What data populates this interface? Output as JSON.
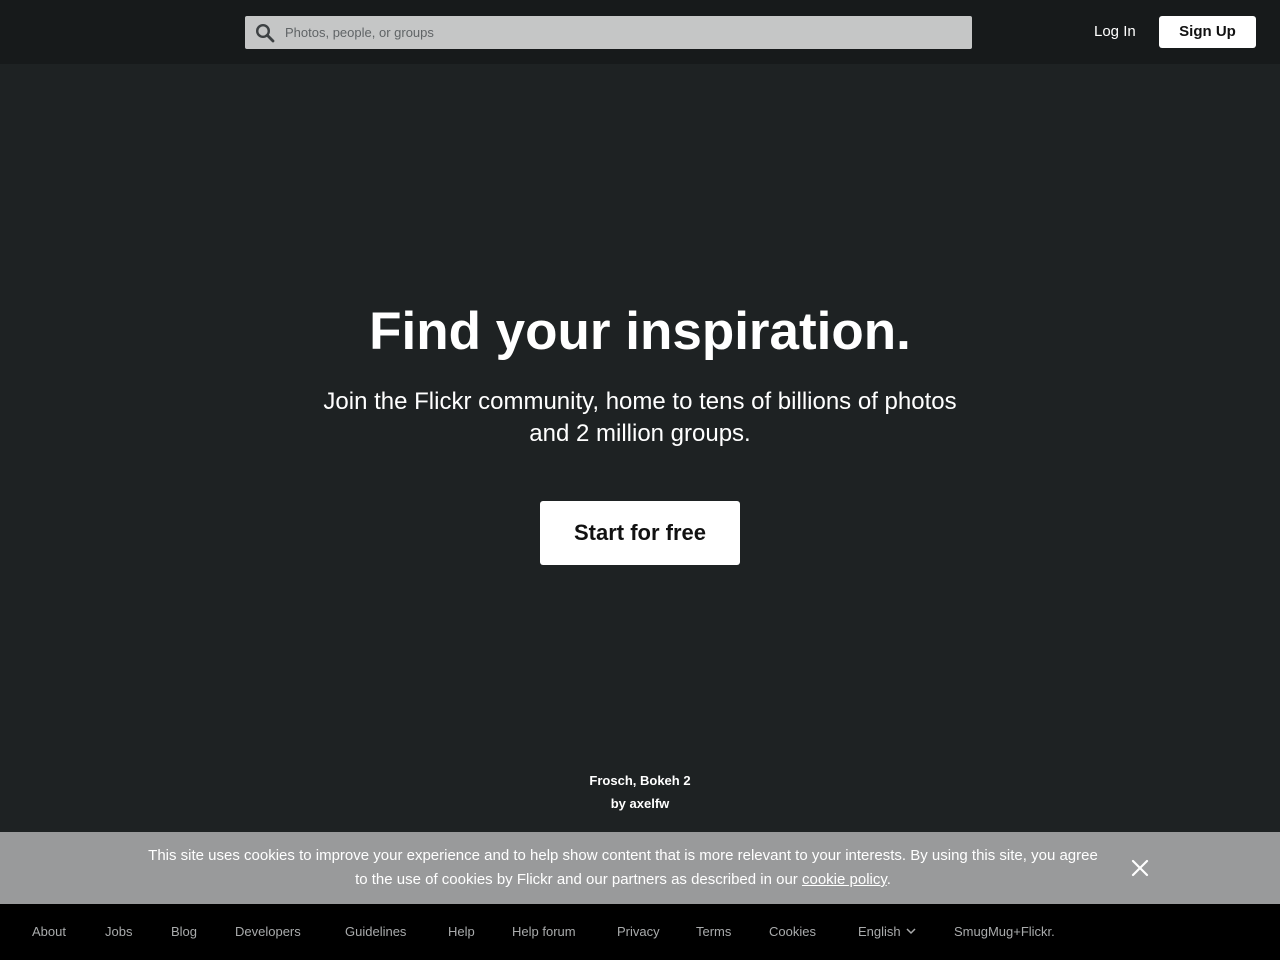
{
  "header": {
    "search": {
      "placeholder": "Photos, people, or groups",
      "value": ""
    },
    "login_label": "Log In",
    "signup_label": "Sign Up"
  },
  "hero": {
    "title": "Find your inspiration.",
    "subtitle": "Join the Flickr community, home to tens of billions of photos and 2 million groups.",
    "cta_label": "Start for free"
  },
  "photo_credit": {
    "title": "Frosch, Bokeh 2",
    "by_prefix": "by ",
    "author": "axelfw"
  },
  "cookie_banner": {
    "text": "This site uses cookies to improve your experience and to help show content that is more relevant to your interests. By using this site, you agree to the use of cookies by Flickr and our partners as described in our ",
    "link_label": "cookie policy",
    "suffix": "."
  },
  "footer": {
    "about": "About",
    "jobs": "Jobs",
    "blog": "Blog",
    "developers": "Developers",
    "guidelines": "Guidelines",
    "help": "Help",
    "help_forum": "Help forum",
    "privacy": "Privacy",
    "terms": "Terms",
    "cookies": "Cookies",
    "language": "English",
    "smugmug": "SmugMug+Flickr."
  },
  "icons": {
    "search": "search-icon",
    "close": "close-icon",
    "language_dropdown": "chevron-down-icon"
  },
  "colors": {
    "background": "#1e2223",
    "header": "#171a1b",
    "search_box": "#c5c6c6",
    "cookie_banner": "#999a9b",
    "footer": "#000000",
    "footer_text": "#a9abac"
  }
}
